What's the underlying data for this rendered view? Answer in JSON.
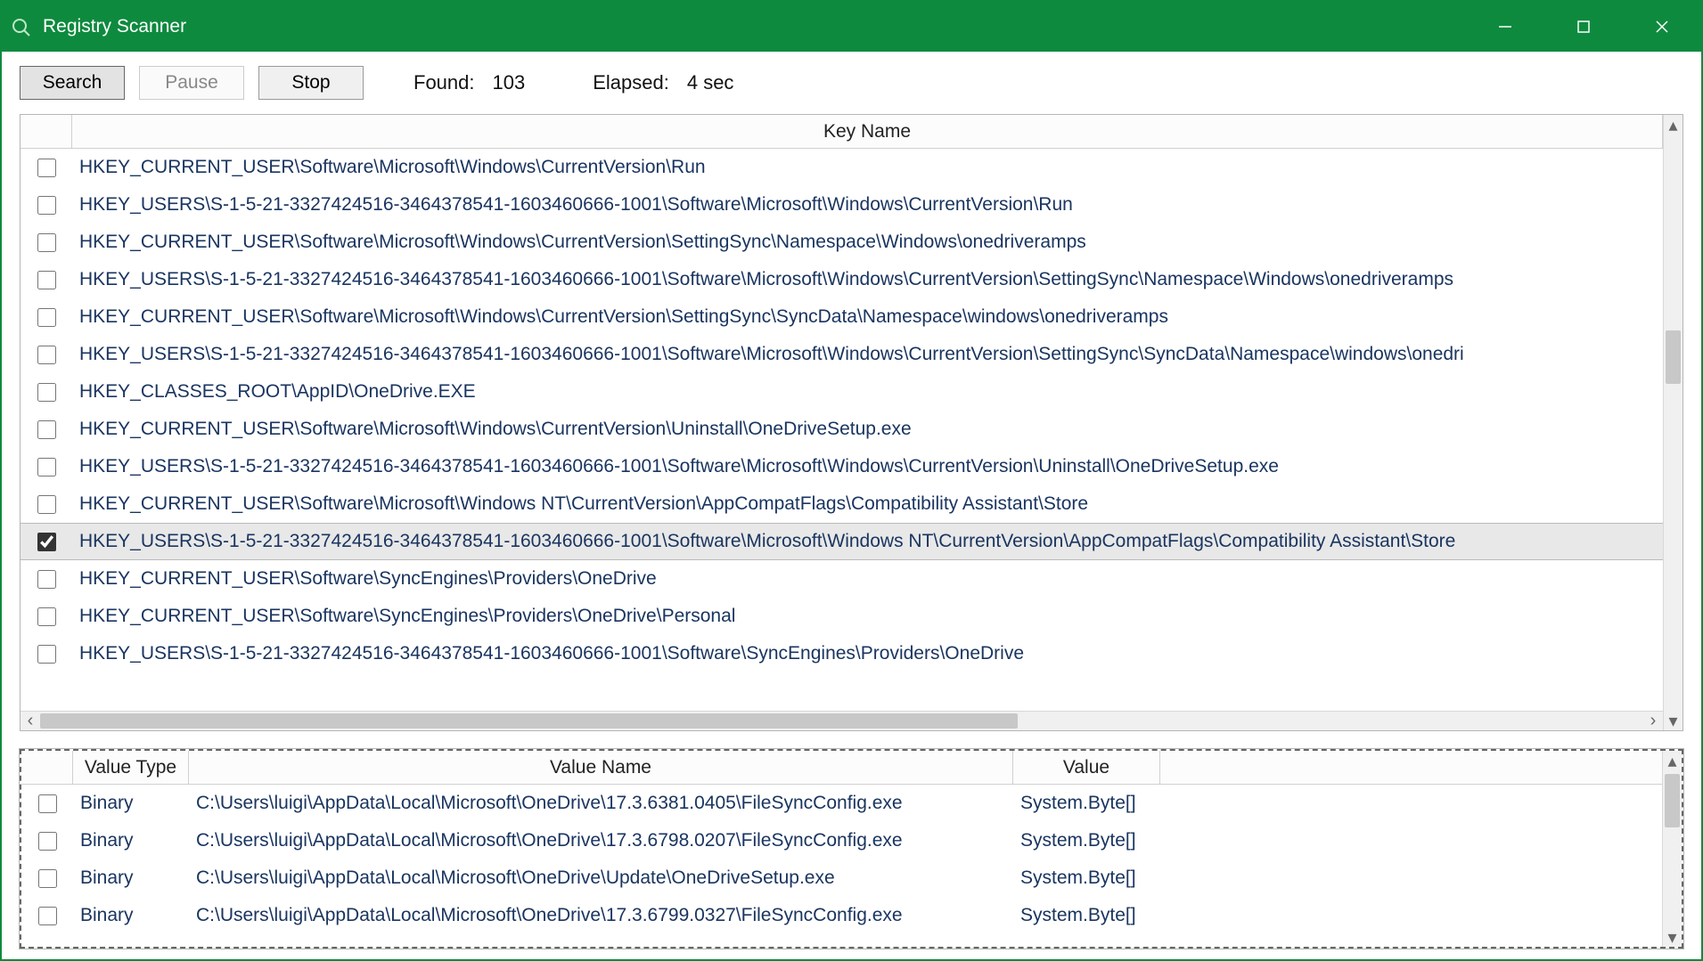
{
  "window": {
    "title": "Registry Scanner"
  },
  "toolbar": {
    "search_label": "Search",
    "pause_label": "Pause",
    "stop_label": "Stop",
    "found_label": "Found:",
    "found_value": "103",
    "elapsed_label": "Elapsed:",
    "elapsed_value": "4 sec"
  },
  "keys_grid": {
    "columns": {
      "keyname": "Key Name"
    },
    "rows": [
      {
        "checked": false,
        "key": "HKEY_CURRENT_USER\\Software\\Microsoft\\Windows\\CurrentVersion\\Run"
      },
      {
        "checked": false,
        "key": "HKEY_USERS\\S-1-5-21-3327424516-3464378541-1603460666-1001\\Software\\Microsoft\\Windows\\CurrentVersion\\Run"
      },
      {
        "checked": false,
        "key": "HKEY_CURRENT_USER\\Software\\Microsoft\\Windows\\CurrentVersion\\SettingSync\\Namespace\\Windows\\onedriveramps"
      },
      {
        "checked": false,
        "key": "HKEY_USERS\\S-1-5-21-3327424516-3464378541-1603460666-1001\\Software\\Microsoft\\Windows\\CurrentVersion\\SettingSync\\Namespace\\Windows\\onedriveramps"
      },
      {
        "checked": false,
        "key": "HKEY_CURRENT_USER\\Software\\Microsoft\\Windows\\CurrentVersion\\SettingSync\\SyncData\\Namespace\\windows\\onedriveramps"
      },
      {
        "checked": false,
        "key": "HKEY_USERS\\S-1-5-21-3327424516-3464378541-1603460666-1001\\Software\\Microsoft\\Windows\\CurrentVersion\\SettingSync\\SyncData\\Namespace\\windows\\onedri"
      },
      {
        "checked": false,
        "key": "HKEY_CLASSES_ROOT\\AppID\\OneDrive.EXE"
      },
      {
        "checked": false,
        "key": "HKEY_CURRENT_USER\\Software\\Microsoft\\Windows\\CurrentVersion\\Uninstall\\OneDriveSetup.exe"
      },
      {
        "checked": false,
        "key": "HKEY_USERS\\S-1-5-21-3327424516-3464378541-1603460666-1001\\Software\\Microsoft\\Windows\\CurrentVersion\\Uninstall\\OneDriveSetup.exe"
      },
      {
        "checked": false,
        "key": "HKEY_CURRENT_USER\\Software\\Microsoft\\Windows NT\\CurrentVersion\\AppCompatFlags\\Compatibility Assistant\\Store"
      },
      {
        "checked": true,
        "selected": true,
        "key": "HKEY_USERS\\S-1-5-21-3327424516-3464378541-1603460666-1001\\Software\\Microsoft\\Windows NT\\CurrentVersion\\AppCompatFlags\\Compatibility Assistant\\Store"
      },
      {
        "checked": false,
        "key": "HKEY_CURRENT_USER\\Software\\SyncEngines\\Providers\\OneDrive"
      },
      {
        "checked": false,
        "key": "HKEY_CURRENT_USER\\Software\\SyncEngines\\Providers\\OneDrive\\Personal"
      },
      {
        "checked": false,
        "key": "HKEY_USERS\\S-1-5-21-3327424516-3464378541-1603460666-1001\\Software\\SyncEngines\\Providers\\OneDrive"
      }
    ]
  },
  "values_grid": {
    "columns": {
      "vtype": "Value Type",
      "vname": "Value Name",
      "vval": "Value"
    },
    "rows": [
      {
        "checked": false,
        "vtype": "Binary",
        "vname": "C:\\Users\\luigi\\AppData\\Local\\Microsoft\\OneDrive\\17.3.6381.0405\\FileSyncConfig.exe",
        "vval": "System.Byte[]"
      },
      {
        "checked": false,
        "vtype": "Binary",
        "vname": "C:\\Users\\luigi\\AppData\\Local\\Microsoft\\OneDrive\\17.3.6798.0207\\FileSyncConfig.exe",
        "vval": "System.Byte[]"
      },
      {
        "checked": false,
        "vtype": "Binary",
        "vname": "C:\\Users\\luigi\\AppData\\Local\\Microsoft\\OneDrive\\Update\\OneDriveSetup.exe",
        "vval": "System.Byte[]"
      },
      {
        "checked": false,
        "vtype": "Binary",
        "vname": "C:\\Users\\luigi\\AppData\\Local\\Microsoft\\OneDrive\\17.3.6799.0327\\FileSyncConfig.exe",
        "vval": "System.Byte[]"
      }
    ]
  }
}
